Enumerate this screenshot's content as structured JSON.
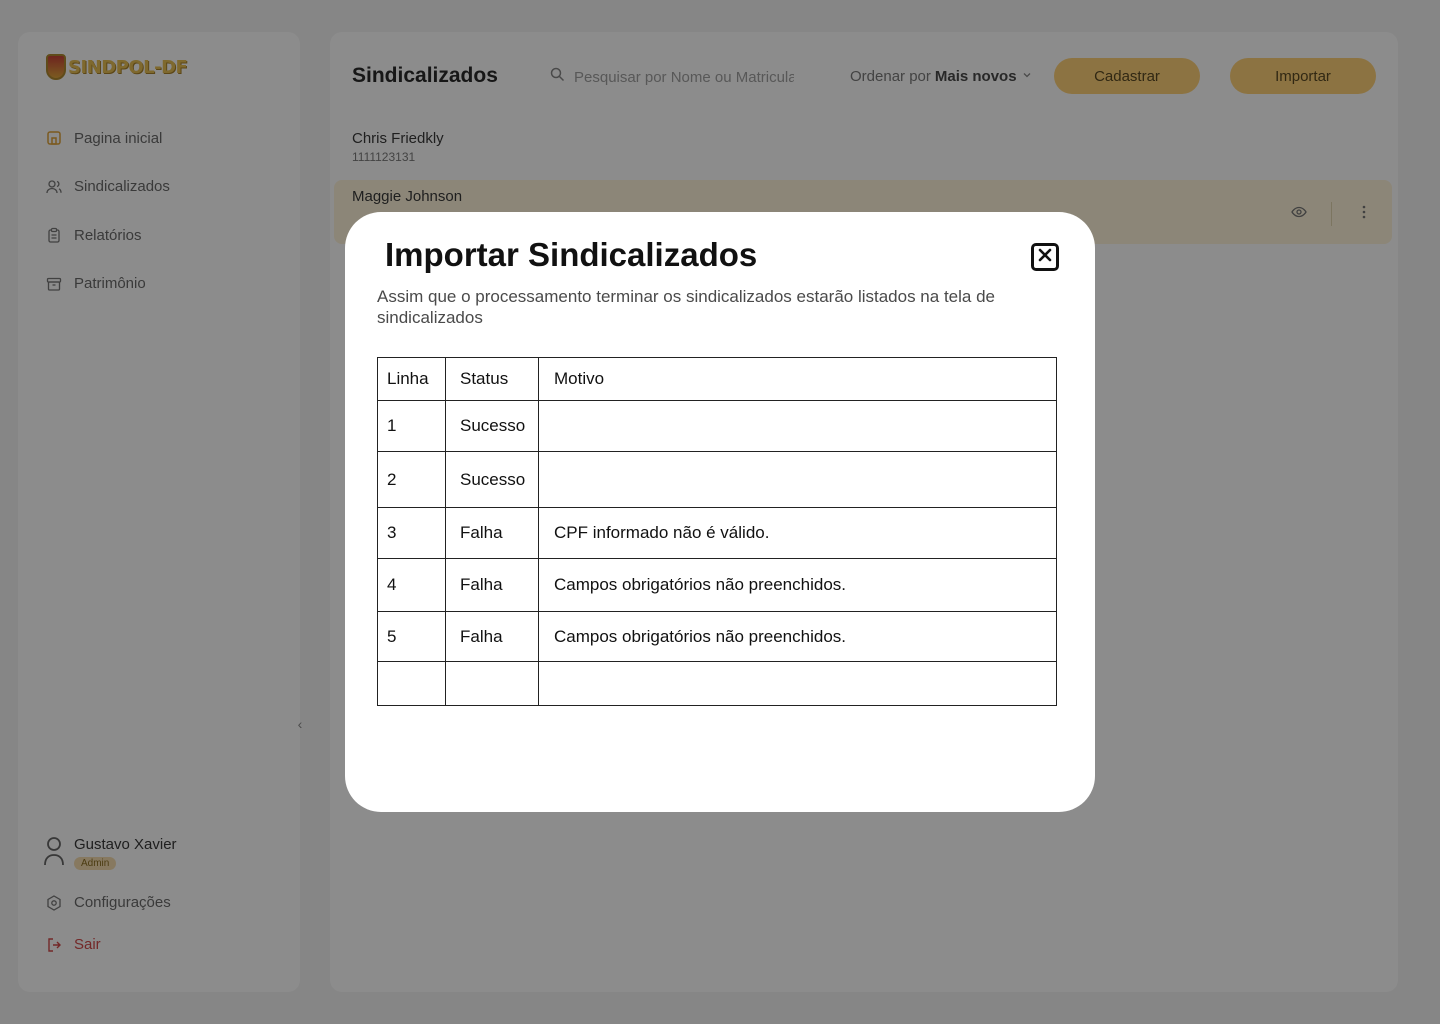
{
  "app": {
    "logo_text": "SINDPOL-DF"
  },
  "sidebar": {
    "items": [
      {
        "label": "Pagina inicial",
        "icon": "home-icon"
      },
      {
        "label": "Sindicalizados",
        "icon": "users-icon"
      },
      {
        "label": "Relatórios",
        "icon": "clipboard-icon"
      },
      {
        "label": "Patrimônio",
        "icon": "archive-icon"
      }
    ],
    "user": {
      "name": "Gustavo Xavier",
      "role": "Admin"
    },
    "settings_label": "Configurações",
    "logout_label": "Sair"
  },
  "header": {
    "title": "Sindicalizados",
    "search_placeholder": "Pesquisar por Nome ou Matricula",
    "sort_label": "Ordenar por",
    "sort_value": "Mais novos",
    "cadastrar_label": "Cadastrar",
    "importar_label": "Importar"
  },
  "members": [
    {
      "name": "Chris Friedkly",
      "id": "1111123131"
    },
    {
      "name": "Maggie Johnson",
      "id": ""
    }
  ],
  "modal": {
    "title": "Importar Sindicalizados",
    "description": "Assim que o processamento terminar os sindicalizados estarão listados na tela de sindicalizados",
    "columns": [
      "Linha",
      "Status",
      "Motivo"
    ],
    "rows": [
      {
        "linha": "1",
        "status": "Sucesso",
        "motivo": ""
      },
      {
        "linha": "2",
        "status": "Sucesso",
        "motivo": ""
      },
      {
        "linha": "3",
        "status": "Falha",
        "motivo": "CPF informado não é válido."
      },
      {
        "linha": "4",
        "status": "Falha",
        "motivo": "Campos obrigatórios não preenchidos."
      },
      {
        "linha": "5",
        "status": "Falha",
        "motivo": "Campos obrigatórios não preenchidos."
      },
      {
        "linha": "",
        "status": "",
        "motivo": ""
      }
    ]
  },
  "colors": {
    "accent": "#ffd179",
    "highlight_row": "#fff4da",
    "danger": "#d24a4a",
    "overlay": "rgba(0,0,0,0.45)"
  }
}
